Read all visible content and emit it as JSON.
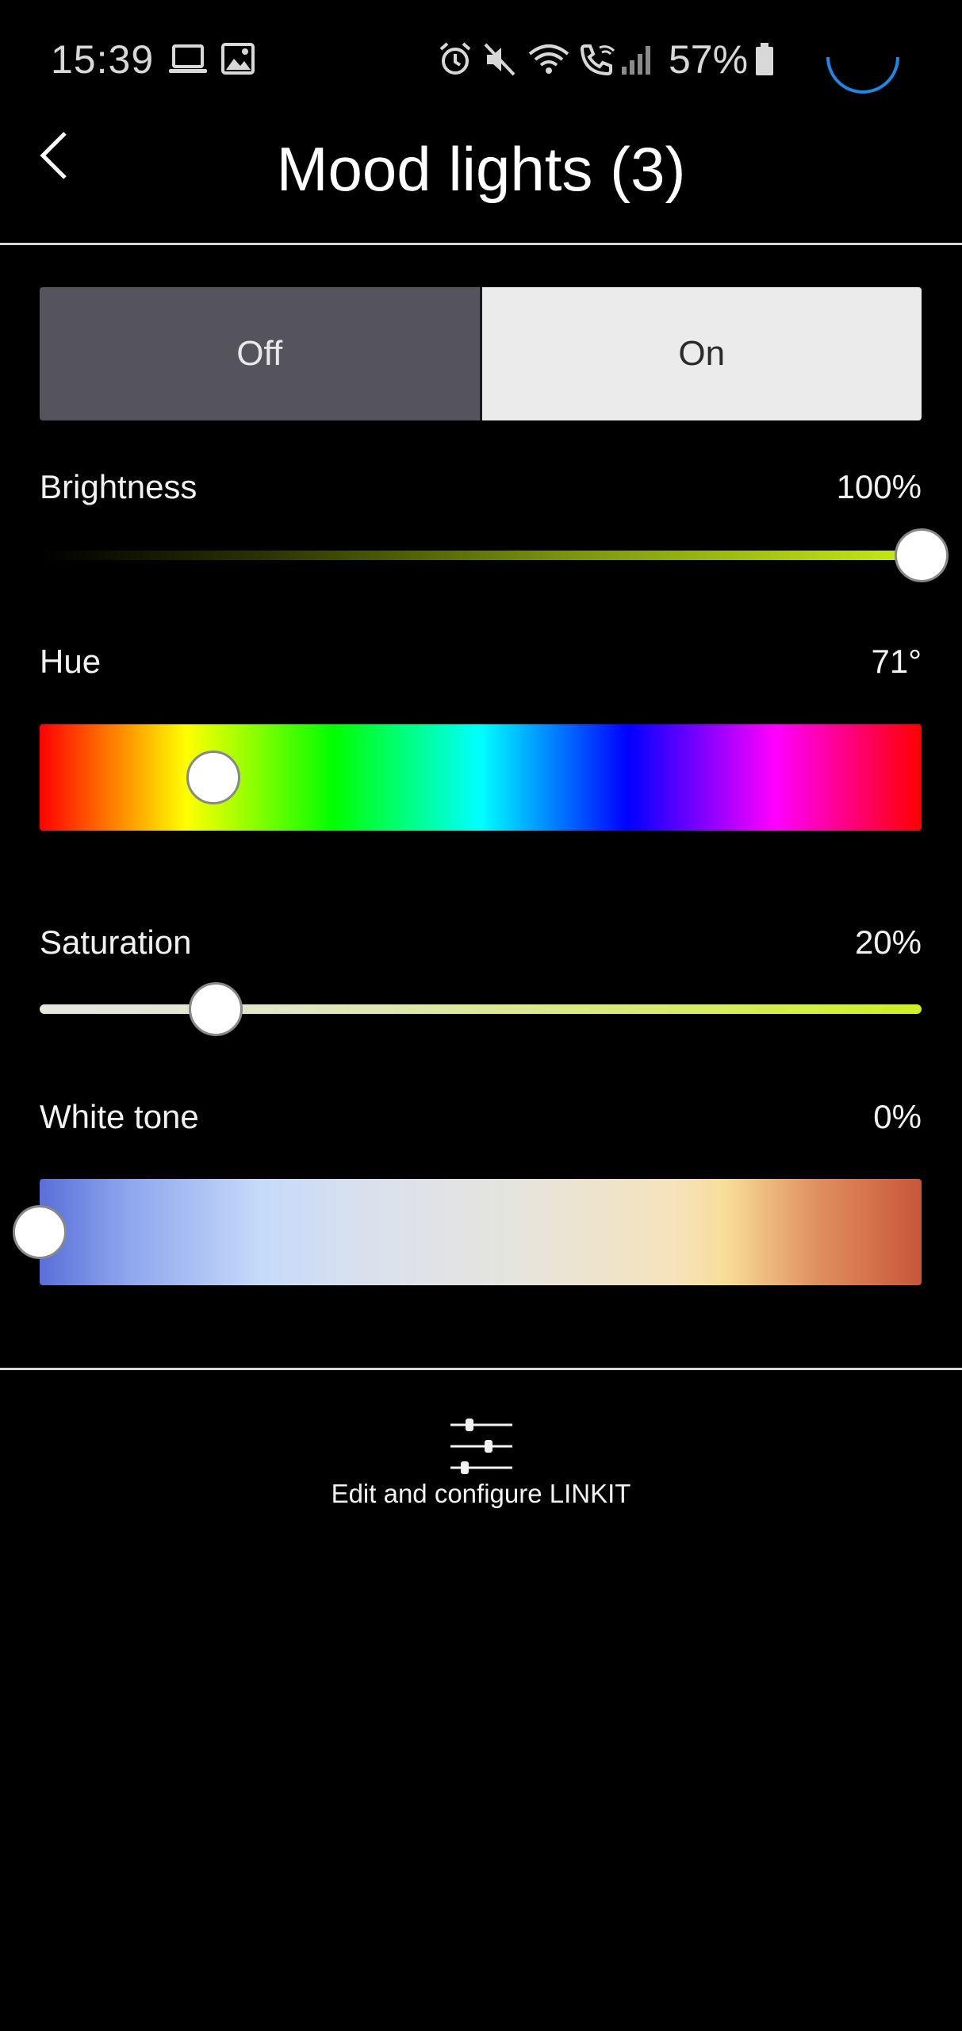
{
  "status_bar": {
    "time": "15:39",
    "battery": "57%",
    "icons": [
      "laptop-icon",
      "image-icon",
      "alarm-icon",
      "mute-icon",
      "wifi-icon",
      "wifi-call-icon",
      "signal-icon",
      "battery-icon"
    ]
  },
  "header": {
    "title": "Mood lights (3)",
    "back_icon": "chevron-left-icon"
  },
  "power_toggle": {
    "off_label": "Off",
    "on_label": "On",
    "selected": "Off"
  },
  "controls": {
    "brightness": {
      "label": "Brightness",
      "value_text": "100%",
      "value": 1.0
    },
    "hue": {
      "label": "Hue",
      "value_text": "71°",
      "value": 71
    },
    "saturation": {
      "label": "Saturation",
      "value_text": "20%",
      "value": 0.2
    },
    "white_tone": {
      "label": "White tone",
      "value_text": "0%",
      "value": 0.0
    }
  },
  "footer": {
    "edit_label": "Edit and configure LINKIT",
    "edit_icon": "sliders-icon"
  },
  "colors": {
    "background": "#000000",
    "toggle_off_bg": "#55545c",
    "toggle_on_bg": "#ebebeb",
    "accent_green": "#c8ec18",
    "spinner": "#1e88e5"
  }
}
